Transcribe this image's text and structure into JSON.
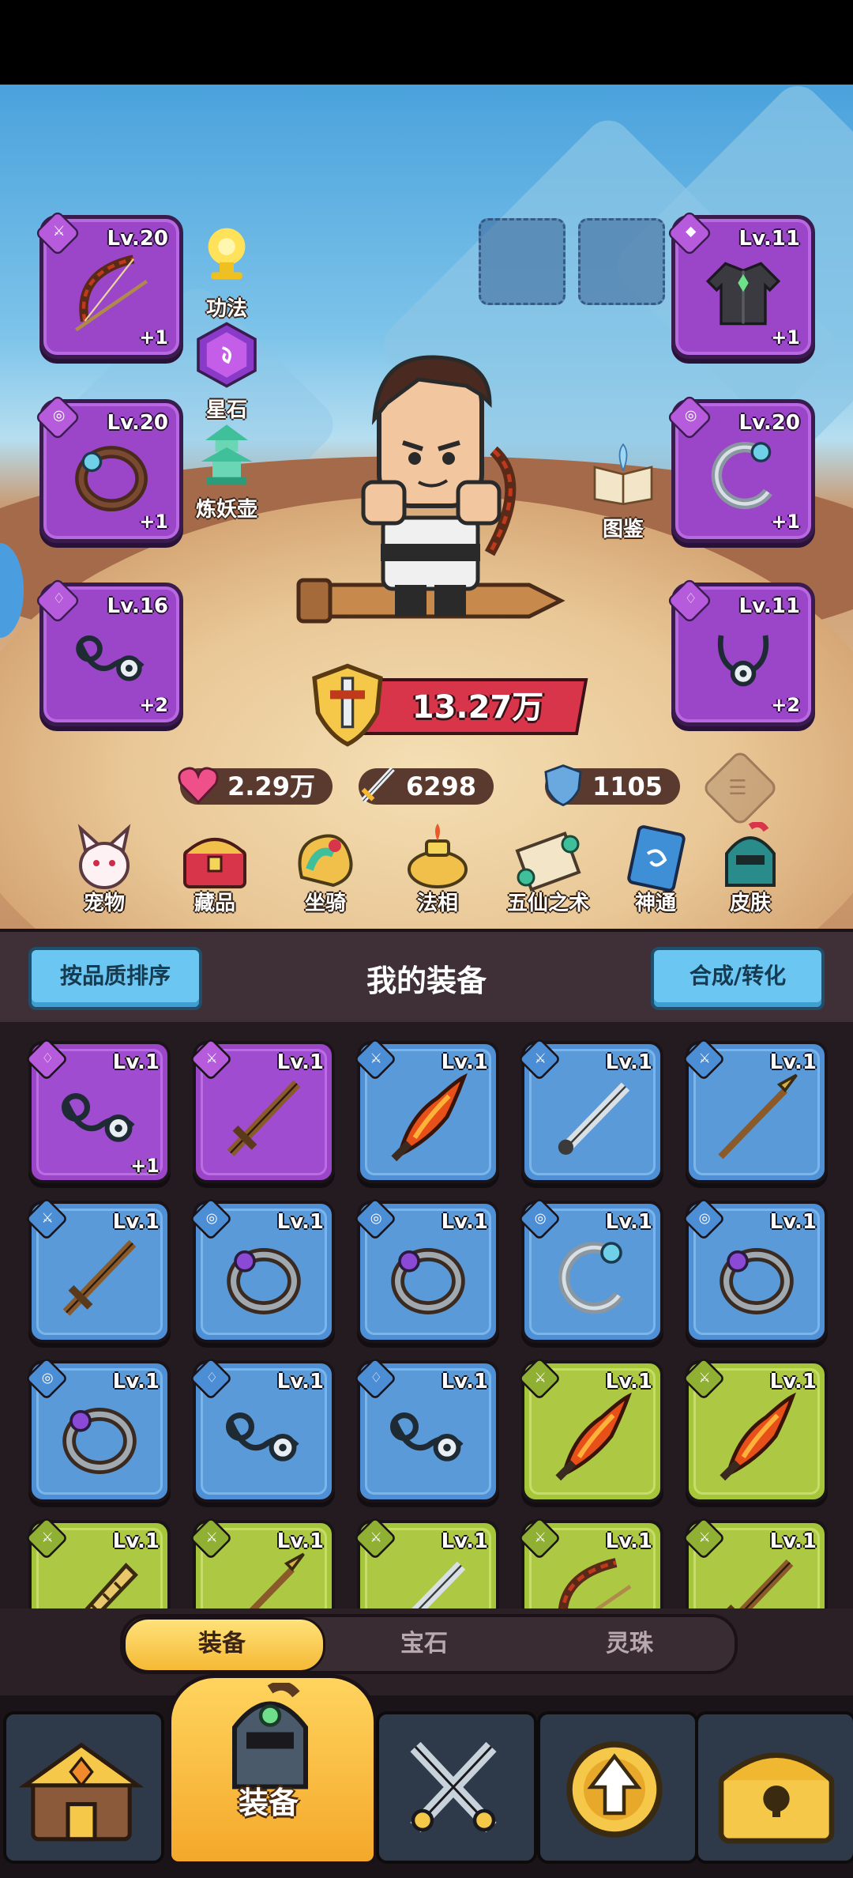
{
  "equip_slots": [
    {
      "level": "Lv.20",
      "plus": "+1",
      "icon": "bow-icon"
    },
    {
      "level": "Lv.20",
      "plus": "+1",
      "icon": "ring-icon"
    },
    {
      "level": "Lv.16",
      "plus": "+2",
      "icon": "necklace-icon"
    },
    {
      "level": "Lv.11",
      "plus": "+1",
      "icon": "armor-icon"
    },
    {
      "level": "Lv.20",
      "plus": "+1",
      "icon": "bracelet-icon"
    },
    {
      "level": "Lv.11",
      "plus": "+2",
      "icon": "necklace-icon"
    }
  ],
  "side_icons": {
    "gongfa": "功法",
    "xingshi": "星石",
    "lianyaohu": "炼妖壶",
    "tujian": "图鉴"
  },
  "power": "13.27万",
  "stats": {
    "hp": "2.29万",
    "attack": "6298",
    "defense": "1105"
  },
  "features": [
    "宠物",
    "藏品",
    "坐骑",
    "法相",
    "五仙之术",
    "神通",
    "皮肤"
  ],
  "panel": {
    "sort_button": "按品质排序",
    "title": "我的装备",
    "merge_button": "合成/转化"
  },
  "inventory": [
    {
      "quality": "purple",
      "level": "Lv.1",
      "plus": "+1",
      "icon": "necklace-icon"
    },
    {
      "quality": "purple",
      "level": "Lv.1",
      "plus": "",
      "icon": "sword-icon"
    },
    {
      "quality": "blue",
      "level": "Lv.1",
      "plus": "",
      "icon": "flame-sword-icon"
    },
    {
      "quality": "blue",
      "level": "Lv.1",
      "plus": "",
      "icon": "dagger-icon"
    },
    {
      "quality": "blue",
      "level": "Lv.1",
      "plus": "",
      "icon": "spear-icon"
    },
    {
      "quality": "blue",
      "level": "Lv.1",
      "plus": "",
      "icon": "sword-icon"
    },
    {
      "quality": "blue",
      "level": "Lv.1",
      "plus": "",
      "icon": "ring-icon"
    },
    {
      "quality": "blue",
      "level": "Lv.1",
      "plus": "",
      "icon": "ring-icon"
    },
    {
      "quality": "blue",
      "level": "Lv.1",
      "plus": "",
      "icon": "bracelet-icon"
    },
    {
      "quality": "blue",
      "level": "Lv.1",
      "plus": "",
      "icon": "ring-icon"
    },
    {
      "quality": "blue",
      "level": "Lv.1",
      "plus": "",
      "icon": "ring-icon"
    },
    {
      "quality": "blue",
      "level": "Lv.1",
      "plus": "",
      "icon": "necklace-icon"
    },
    {
      "quality": "blue",
      "level": "Lv.1",
      "plus": "",
      "icon": "necklace-icon"
    },
    {
      "quality": "green",
      "level": "Lv.1",
      "plus": "",
      "icon": "flame-sword-icon"
    },
    {
      "quality": "green",
      "level": "Lv.1",
      "plus": "",
      "icon": "flame-sword-icon"
    },
    {
      "quality": "green",
      "level": "Lv.1",
      "plus": "",
      "icon": "saw-blade-icon"
    },
    {
      "quality": "green",
      "level": "Lv.1",
      "plus": "",
      "icon": "spear-icon"
    },
    {
      "quality": "green",
      "level": "Lv.1",
      "plus": "",
      "icon": "dagger-icon"
    },
    {
      "quality": "green",
      "level": "Lv.1",
      "plus": "",
      "icon": "bow-icon"
    },
    {
      "quality": "green",
      "level": "Lv.1",
      "plus": "",
      "icon": "sword-icon"
    }
  ],
  "tabs": [
    "装备",
    "宝石",
    "灵珠"
  ],
  "active_tab": "装备",
  "bottom_nav": {
    "active_label": "装备",
    "items": [
      "shop-icon",
      "equipment-helmet-icon",
      "crossed-swords-icon",
      "upgrade-icon",
      "treasure-chest-icon"
    ]
  },
  "colors": {
    "purple": "#9b45c8",
    "blue": "#5a9ad8",
    "green": "#adc943",
    "accent": "#f5b935"
  }
}
